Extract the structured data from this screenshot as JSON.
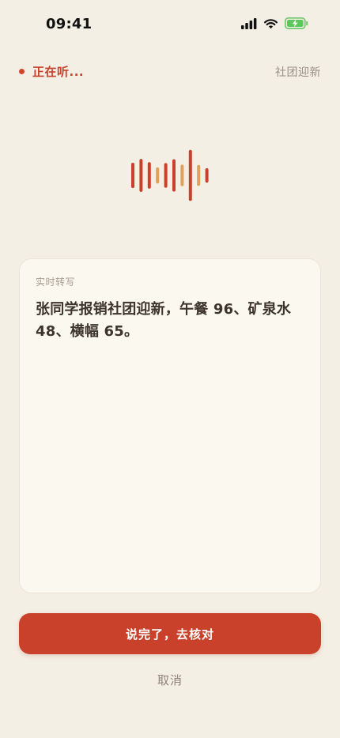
{
  "status_bar": {
    "time": "09:41"
  },
  "header": {
    "listening_text": "正在听...",
    "context_tag": "社团迎新"
  },
  "colors": {
    "accent_red": "#c9412a",
    "accent_orange": "#e0a15a",
    "background": "#f4efe4",
    "card_background": "#fbf8f0"
  },
  "waveform": {
    "levels": [
      0.42,
      0.55,
      0.44,
      0.27,
      0.41,
      0.54,
      0.36,
      0.85,
      0.35,
      0.24
    ],
    "highlight_indices": [
      3,
      6,
      8
    ]
  },
  "transcript": {
    "label": "实时转写",
    "text": "张同学报销社团迎新，午餐 96、矿泉水 48、横幅 65。"
  },
  "actions": {
    "done_label": "说完了，去核对",
    "cancel_label": "取消"
  }
}
